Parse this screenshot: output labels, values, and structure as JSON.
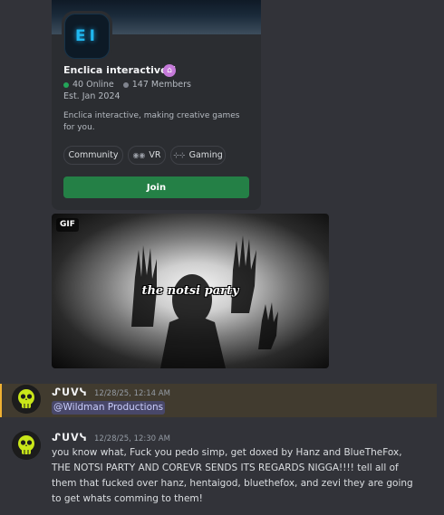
{
  "invite": {
    "guild_name": "Enclica interactive™",
    "guild_icon_text": "EI",
    "online": "40 Online",
    "members": "147 Members",
    "established": "Est. Jan 2024",
    "description": "Enclica interactive, making creative games for you.",
    "tags": [
      "Community",
      "VR",
      "Gaming"
    ],
    "join_label": "Join",
    "colors": {
      "join": "#248046",
      "online_dot": "#23a559",
      "house_icon": "#c57ad9"
    }
  },
  "gif": {
    "badge": "GIF",
    "caption": "the notsi party"
  },
  "messages": [
    {
      "username": "ᔑᑌᐯᓭ",
      "timestamp": "12/28/25, 12:14 AM",
      "mention": "@Wildman Productions",
      "highlighted": true
    },
    {
      "username": "ᔑᑌᐯᓭ",
      "timestamp": "12/28/25, 12:30 AM",
      "text": "you know what, Fuck you pedo simp, get doxed by Hanz and BlueTheFox, THE NOTSI PARTY AND COREVR SENDS ITS REGARDS NIGGA!!!! tell all of them that fucked over hanz, hentaigod, bluethefox, and zevi they are going to get whats comming to them!"
    }
  ]
}
